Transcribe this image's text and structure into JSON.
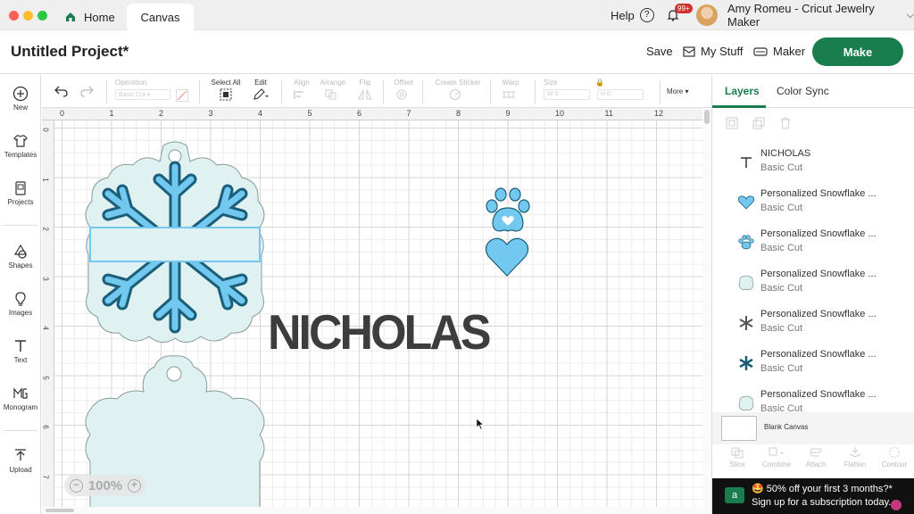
{
  "titlebar": {
    "home_label": "Home",
    "canvas_tab": "Canvas",
    "help_label": "Help",
    "notif_badge": "99+",
    "account_label": "Amy Romeu - Cricut Jewelry Maker"
  },
  "header": {
    "project_title": "Untitled Project*",
    "save_label": "Save",
    "mystuff_label": "My Stuff",
    "maker_label": "Maker",
    "make_label": "Make"
  },
  "sidebar": {
    "items": [
      {
        "label": "New",
        "icon": "plus-circle-icon"
      },
      {
        "label": "Templates",
        "icon": "shirt-icon"
      },
      {
        "label": "Projects",
        "icon": "projects-icon"
      },
      {
        "label": "Shapes",
        "icon": "shapes-icon"
      },
      {
        "label": "Images",
        "icon": "lightbulb-icon"
      },
      {
        "label": "Text",
        "icon": "text-t-icon"
      },
      {
        "label": "Monogram",
        "icon": "monogram-icon"
      },
      {
        "label": "Upload",
        "icon": "upload-icon"
      }
    ]
  },
  "toolbar": {
    "operation_label": "Operation",
    "operation_value": "Basic Cut",
    "select_all_label": "Select All",
    "edit_label": "Edit",
    "align_label": "Align",
    "arrange_label": "Arrange",
    "flip_label": "Flip",
    "offset_label": "Offset",
    "create_sticker_label": "Create Sticker",
    "warp_label": "Warp",
    "size_label": "Size",
    "w_label": "W",
    "w_value": "0",
    "h_label": "H",
    "h_value": "0",
    "more_label": "More"
  },
  "rulers": {
    "top": [
      "0",
      "1",
      "2",
      "3",
      "4",
      "5",
      "6",
      "7",
      "8",
      "9",
      "10",
      "11",
      "12"
    ],
    "left": [
      "0",
      "1",
      "2",
      "3",
      "4",
      "5",
      "6",
      "7"
    ]
  },
  "canvas": {
    "text_object": "NICHOLAS",
    "zoom": "100%",
    "colors": {
      "light_blue": "#72c8ee",
      "mid_blue": "#2f8bb9",
      "dark_teal": "#1b5e7a",
      "pale_mint": "#dff1f1",
      "text_gray": "#3d3d3d"
    }
  },
  "rpanel": {
    "tab_layers": "Layers",
    "tab_colorsync": "Color Sync",
    "layers": [
      {
        "name": "NICHOLAS",
        "sub": "Basic Cut",
        "icon": "text-t-icon"
      },
      {
        "name": "Personalized Snowflake ...",
        "sub": "Basic Cut",
        "icon": "heart-icon"
      },
      {
        "name": "Personalized Snowflake ...",
        "sub": "Basic Cut",
        "icon": "paw-icon"
      },
      {
        "name": "Personalized Snowflake ...",
        "sub": "Basic Cut",
        "icon": "tag-outline-icon"
      },
      {
        "name": "Personalized Snowflake ...",
        "sub": "Basic Cut",
        "icon": "snowflake-icon"
      },
      {
        "name": "Personalized Snowflake ...",
        "sub": "Basic Cut",
        "icon": "snowflake-icon"
      },
      {
        "name": "Personalized Snowflake ...",
        "sub": "Basic Cut",
        "icon": "tag-outline-icon"
      }
    ],
    "blank_canvas": "Blank Canvas",
    "actions": [
      "Slice",
      "Combine",
      "Attach",
      "Flatten",
      "Contour"
    ],
    "promo_line1": "🤩 50% off your first 3 months?*",
    "promo_line2": "Sign up for a subscription today."
  }
}
